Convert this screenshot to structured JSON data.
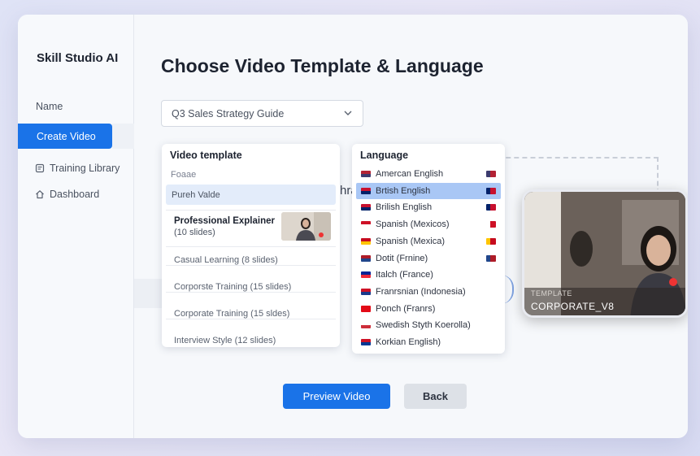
{
  "app": {
    "title": "Skill Studio AI"
  },
  "sidebar": {
    "items": [
      {
        "label": "Name"
      },
      {
        "label": "Create Video"
      },
      {
        "label": "Training Library",
        "icon": "book-icon"
      },
      {
        "label": "Dashboard",
        "icon": "home-icon"
      }
    ]
  },
  "main": {
    "title": "Choose Video Template & Language",
    "guide_select": {
      "value": "Q3 Sales Strategy Guide"
    },
    "ghost_text": "hra"
  },
  "video_template": {
    "heading": "Video template",
    "search_text": "Foaae",
    "highlighted": "Pureh Valde",
    "selected": {
      "title": "Professional Explainer",
      "subtitle": "(10 slides)"
    },
    "items": [
      "Casual Learning (8 slides)",
      "Corporste Training (15 slides)",
      "Corporate Training (15 sldes)",
      "Interview Style (12 slides)"
    ]
  },
  "language": {
    "heading": "Language",
    "items": [
      {
        "label": "Amercan English",
        "flag_colors": [
          "#b22234",
          "#3c3b6e"
        ],
        "right_flag": true
      },
      {
        "label": "Brtish English",
        "flag_colors": [
          "#c8102e",
          "#012169"
        ],
        "right_flag": true,
        "selected": true
      },
      {
        "label": "Brilish English",
        "flag_colors": [
          "#c8102e",
          "#012169"
        ],
        "right_flag": true
      },
      {
        "label": "Spanish (Mexicos)",
        "flag_colors": [
          "#ce1126",
          "#ffffff"
        ],
        "right_flag": true
      },
      {
        "label": "Spanish (Mexica)",
        "flag_colors": [
          "#c60b1e",
          "#ffc400"
        ],
        "right_flag": true
      },
      {
        "label": "Dotit  (Frnine)",
        "flag_colors": [
          "#ae1c28",
          "#21468b"
        ],
        "right_flag": true
      },
      {
        "label": "Italch (France)",
        "flag_colors": [
          "#002395",
          "#ed2939"
        ],
        "right_flag": false
      },
      {
        "label": "Franrsnian (Indonesia)",
        "flag_colors": [
          "#ce1126",
          "#1a3a8a"
        ],
        "right_flag": false
      },
      {
        "label": "Ponch (Franrs)",
        "flag_colors": [
          "#e30a17",
          "#e30a17"
        ],
        "right_flag": false
      },
      {
        "label": "Swedish Styth Koerolla)",
        "flag_colors": [
          "#ffffff",
          "#cd2e3a"
        ],
        "right_flag": false
      },
      {
        "label": "Korkian English)",
        "flag_colors": [
          "#ce1126",
          "#003893"
        ],
        "right_flag": false
      }
    ]
  },
  "preview_card": {
    "tag": "TEMPLATE",
    "name": "CORPORATE_V8"
  },
  "buttons": {
    "preview": "Preview Video",
    "back": "Back"
  },
  "colors": {
    "accent": "#1a73e8",
    "selected_row": "#a9c7f5"
  }
}
